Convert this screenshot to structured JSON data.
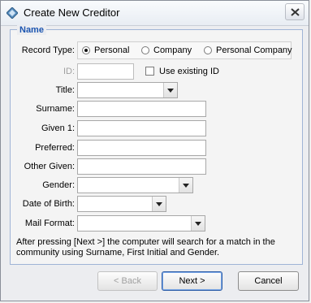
{
  "window": {
    "title": "Create New Creditor"
  },
  "group": {
    "legend": "Name"
  },
  "record_type": {
    "label": "Record Type:",
    "options": [
      {
        "label": "Personal",
        "selected": true
      },
      {
        "label": "Company",
        "selected": false
      },
      {
        "label": "Personal Company",
        "selected": false
      }
    ]
  },
  "id_field": {
    "label": "ID:",
    "value": "",
    "use_existing_label": "Use existing ID",
    "use_existing_checked": false
  },
  "fields": {
    "title": {
      "label": "Title:",
      "value": ""
    },
    "surname": {
      "label": "Surname:",
      "value": ""
    },
    "given1": {
      "label": "Given 1:",
      "value": ""
    },
    "preferred": {
      "label": "Preferred:",
      "value": ""
    },
    "other_given": {
      "label": "Other Given:",
      "value": ""
    },
    "gender": {
      "label": "Gender:",
      "value": ""
    },
    "dob": {
      "label": "Date of Birth:",
      "value": ""
    },
    "mail_format": {
      "label": "Mail Format:",
      "value": ""
    }
  },
  "note": "After pressing [Next >] the computer will search for a match in the community using Surname, First Initial and Gender.",
  "buttons": {
    "back": "< Back",
    "next": "Next >",
    "cancel": "Cancel"
  },
  "colors": {
    "legend": "#1b55b0",
    "accent_border": "#2f5fa8"
  },
  "icons": {
    "app": "diamond-app-icon",
    "close": "close-icon"
  }
}
